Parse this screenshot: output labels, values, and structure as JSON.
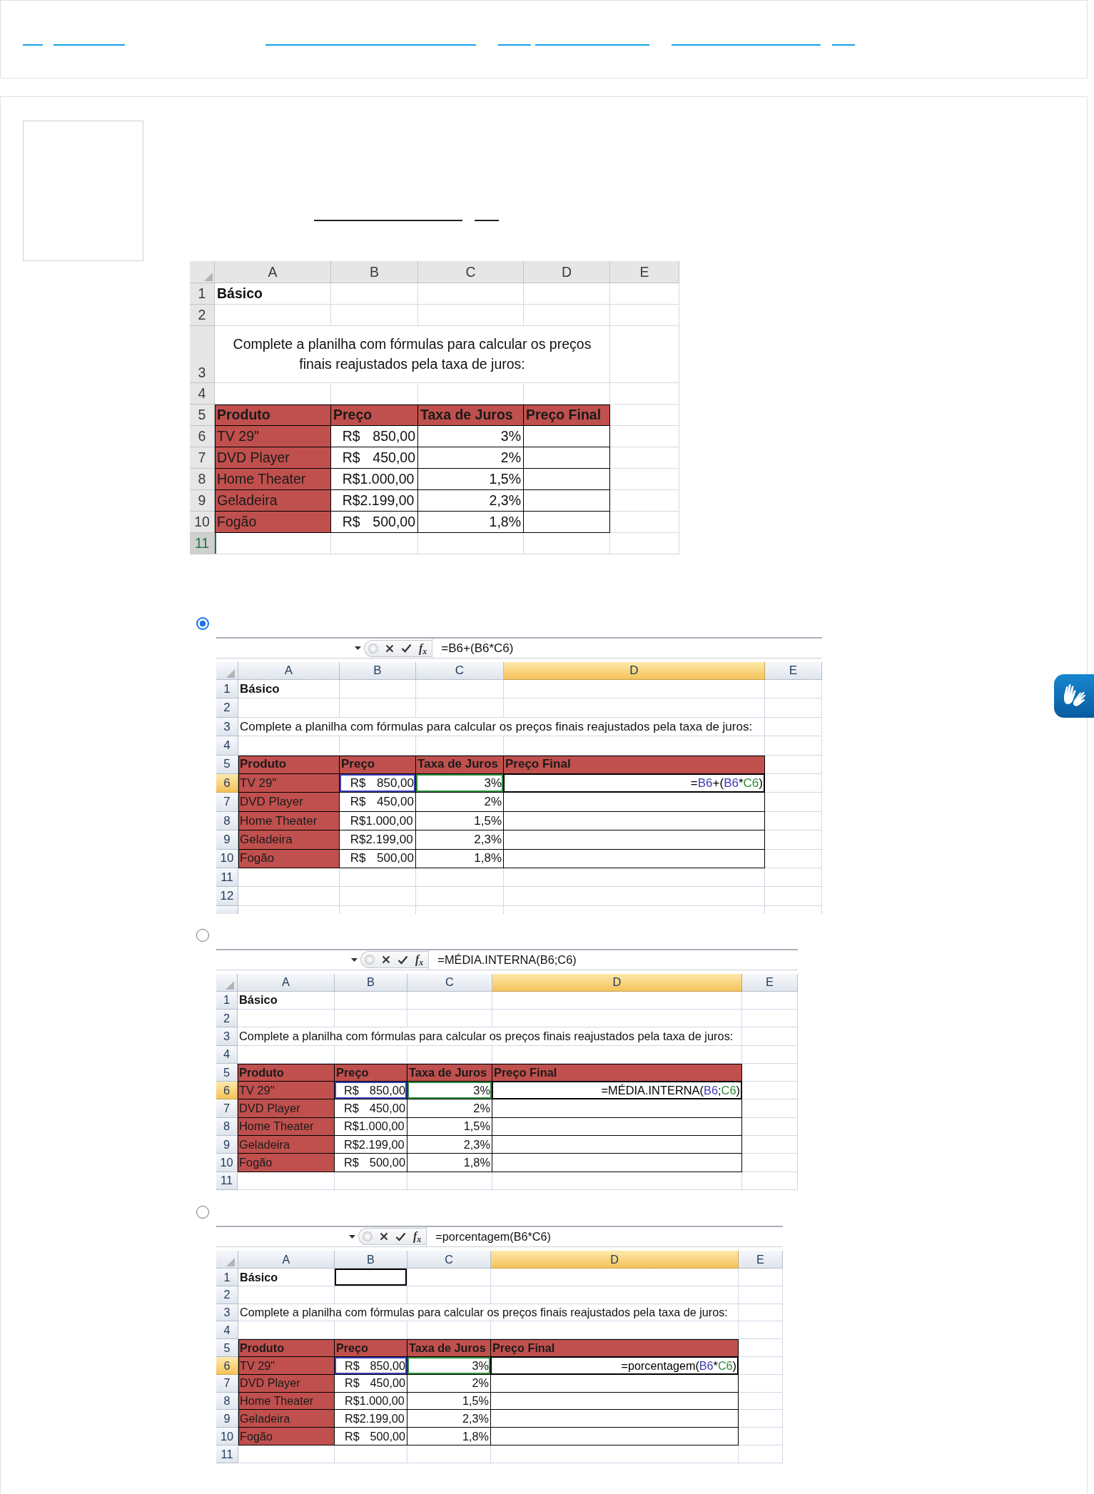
{
  "question": {
    "spreadsheet": {
      "kind": "excel2016",
      "columns": [
        {
          "label": "A",
          "selected": false
        },
        {
          "label": "B",
          "selected": false
        },
        {
          "label": "C",
          "selected": false
        },
        {
          "label": "D",
          "selected": false
        },
        {
          "label": "E",
          "selected": false
        }
      ],
      "rows": [
        {
          "number": "1",
          "selected": false,
          "kind": "title",
          "cells": [
            {
              "text": "Básico"
            }
          ]
        },
        {
          "number": "2",
          "selected": false,
          "kind": "blank"
        },
        {
          "number": "3",
          "selected": false,
          "kind": "note",
          "cells": [
            {
              "text": "Complete a planilha com fórmulas para calcular os preços finais reajustados pela taxa de juros:"
            }
          ]
        },
        {
          "number": "4",
          "selected": false,
          "kind": "blank"
        },
        {
          "number": "5",
          "selected": false,
          "kind": "header",
          "cells": [
            {
              "text": "Produto"
            },
            {
              "text": "Preço"
            },
            {
              "text": "Taxa de Juros"
            },
            {
              "text": "Preço Final"
            }
          ]
        },
        {
          "number": "6",
          "selected": false,
          "kind": "data",
          "cells": [
            {
              "text": "TV 29\""
            },
            {
              "text": "R$ 850,00"
            },
            {
              "text": "3%"
            }
          ]
        },
        {
          "number": "7",
          "selected": false,
          "kind": "data",
          "cells": [
            {
              "text": "DVD Player"
            },
            {
              "text": "R$ 450,00"
            },
            {
              "text": "2%"
            }
          ]
        },
        {
          "number": "8",
          "selected": false,
          "kind": "data",
          "cells": [
            {
              "text": "Home Theater"
            },
            {
              "text": "R$1.000,00"
            },
            {
              "text": "1,5%"
            }
          ]
        },
        {
          "number": "9",
          "selected": false,
          "kind": "data",
          "cells": [
            {
              "text": "Geladeira"
            },
            {
              "text": "R$2.199,00"
            },
            {
              "text": "2,3%"
            }
          ]
        },
        {
          "number": "10",
          "selected": false,
          "kind": "data",
          "cells": [
            {
              "text": "Fogão"
            },
            {
              "text": "R$ 500,00"
            },
            {
              "text": "1,8%"
            }
          ]
        },
        {
          "number": "11",
          "selected": true,
          "kind": "blank"
        }
      ]
    }
  },
  "options": [
    {
      "selected": true,
      "spreadsheet": {
        "kind": "excel2010",
        "formula": "=B6+(B6*C6)",
        "function_label": "f$_{x}$",
        "columns": [
          {
            "label": "A",
            "selected": false
          },
          {
            "label": "B",
            "selected": false
          },
          {
            "label": "C",
            "selected": false
          },
          {
            "label": "D",
            "selected": true
          },
          {
            "label": "E",
            "selected": false
          }
        ],
        "rows": [
          {
            "number": "1",
            "selected": false,
            "kind": "title",
            "cells": [
              {
                "text": "Básico"
              }
            ]
          },
          {
            "number": "2",
            "selected": false,
            "kind": "blank"
          },
          {
            "number": "3",
            "selected": false,
            "kind": "note",
            "cells": [
              {
                "text": "Complete a planilha com fórmulas para calcular os preços finais reajustados pela taxa de juros:"
              }
            ]
          },
          {
            "number": "4",
            "selected": false,
            "kind": "blank"
          },
          {
            "number": "5",
            "selected": false,
            "kind": "header",
            "cells": [
              {
                "text": "Produto"
              },
              {
                "text": "Preço"
              },
              {
                "text": "Taxa de Juros"
              },
              {
                "text": "Preço Final"
              }
            ]
          },
          {
            "number": "6",
            "selected": true,
            "kind": "data",
            "cells": [
              {
                "text": "TV 29\""
              },
              {
                "text": "R$ 850,00",
                "color": "#3c3cb4"
              },
              {
                "text": "3%",
                "color": "#2e8b3a"
              },
              {
                "parts": [
                  {
                    "text": "="
                  },
                  {
                    "text": "B6",
                    "color": "#3c3cb4"
                  },
                  {
                    "text": "+("
                  },
                  {
                    "text": "B6",
                    "color": "#3c3cb4"
                  },
                  {
                    "text": "*"
                  },
                  {
                    "text": "C6",
                    "color": "#2e8b3a"
                  },
                  {
                    "text": ")"
                  }
                ]
              }
            ]
          },
          {
            "number": "7",
            "selected": false,
            "kind": "data",
            "cells": [
              {
                "text": "DVD Player"
              },
              {
                "text": "R$ 450,00"
              },
              {
                "text": "2%"
              }
            ]
          },
          {
            "number": "8",
            "selected": false,
            "kind": "data",
            "cells": [
              {
                "text": "Home Theater"
              },
              {
                "text": "R$1.000,00"
              },
              {
                "text": "1,5%"
              }
            ]
          },
          {
            "number": "9",
            "selected": false,
            "kind": "data",
            "cells": [
              {
                "text": "Geladeira"
              },
              {
                "text": "R$2.199,00"
              },
              {
                "text": "2,3%"
              }
            ]
          },
          {
            "number": "10",
            "selected": false,
            "kind": "data",
            "cells": [
              {
                "text": "Fogão"
              },
              {
                "text": "R$ 500,00"
              },
              {
                "text": "1,8%"
              }
            ]
          },
          {
            "number": "11",
            "selected": false,
            "kind": "blank"
          },
          {
            "number": "12",
            "selected": false,
            "kind": "blank"
          },
          {
            "selected": false,
            "kind": "blank"
          }
        ]
      }
    },
    {
      "selected": false,
      "spreadsheet": {
        "kind": "excel2010",
        "formula": "=MÉDIA.INTERNA(B6;C6)",
        "function_label": "f$_{x}$",
        "columns": [
          {
            "label": "A",
            "selected": false
          },
          {
            "label": "B",
            "selected": false
          },
          {
            "label": "C",
            "selected": false
          },
          {
            "label": "D",
            "selected": true
          },
          {
            "label": "E",
            "selected": false
          }
        ],
        "rows": [
          {
            "number": "1",
            "selected": false,
            "kind": "title",
            "cells": [
              {
                "text": "Básico"
              }
            ]
          },
          {
            "number": "2",
            "selected": false,
            "kind": "blank"
          },
          {
            "number": "3",
            "selected": false,
            "kind": "note",
            "cells": [
              {
                "text": "Complete a planilha com fórmulas para calcular os preços finais reajustados pela taxa de juros:"
              }
            ]
          },
          {
            "number": "4",
            "selected": false,
            "kind": "blank"
          },
          {
            "number": "5",
            "selected": false,
            "kind": "header",
            "cells": [
              {
                "text": "Produto"
              },
              {
                "text": "Preço"
              },
              {
                "text": "Taxa de Juros"
              },
              {
                "text": "Preço Final"
              }
            ]
          },
          {
            "number": "6",
            "selected": true,
            "kind": "data",
            "cells": [
              {
                "text": "TV 29\""
              },
              {
                "text": "R$ 850,00",
                "color": "#3c3cb4"
              },
              {
                "text": "3%",
                "color": "#2e8b3a"
              },
              {
                "parts": [
                  {
                    "text": "=MÉDIA.INTERNA("
                  },
                  {
                    "text": "B6",
                    "color": "#3c3cb4"
                  },
                  {
                    "text": ";"
                  },
                  {
                    "text": "C6",
                    "color": "#2e8b3a"
                  },
                  {
                    "text": ")"
                  }
                ]
              }
            ]
          },
          {
            "number": "7",
            "selected": false,
            "kind": "data",
            "cells": [
              {
                "text": "DVD Player"
              },
              {
                "text": "R$ 450,00"
              },
              {
                "text": "2%"
              }
            ]
          },
          {
            "number": "8",
            "selected": false,
            "kind": "data",
            "cells": [
              {
                "text": "Home Theater"
              },
              {
                "text": "R$1.000,00"
              },
              {
                "text": "1,5%"
              }
            ]
          },
          {
            "number": "9",
            "selected": false,
            "kind": "data",
            "cells": [
              {
                "text": "Geladeira"
              },
              {
                "text": "R$2.199,00"
              },
              {
                "text": "2,3%"
              }
            ]
          },
          {
            "number": "10",
            "selected": false,
            "kind": "data",
            "cells": [
              {
                "text": "Fogão"
              },
              {
                "text": "R$ 500,00"
              },
              {
                "text": "1,8%"
              }
            ]
          },
          {
            "number": "11",
            "selected": false,
            "kind": "blank"
          }
        ]
      }
    },
    {
      "selected": false,
      "spreadsheet": {
        "kind": "excel2010",
        "formula": "=porcentagem(B6*C6)",
        "function_label": "f$_{x}$",
        "columns": [
          {
            "label": "A",
            "selected": false
          },
          {
            "label": "B",
            "selected": false
          },
          {
            "label": "C",
            "selected": false
          },
          {
            "label": "D",
            "selected": true
          },
          {
            "label": "E",
            "selected": false
          }
        ],
        "rows": [
          {
            "number": "1",
            "selected": false,
            "kind": "title",
            "cells": [
              {
                "text": "Básico"
              },
              {
                "outlined": true
              }
            ]
          },
          {
            "number": "2",
            "selected": false,
            "kind": "blank"
          },
          {
            "number": "3",
            "selected": false,
            "kind": "note",
            "cells": [
              {
                "text": "Complete a planilha com fórmulas para calcular os preços finais reajustados pela taxa de juros:"
              }
            ]
          },
          {
            "number": "4",
            "selected": false,
            "kind": "blank"
          },
          {
            "number": "5",
            "selected": false,
            "kind": "header",
            "cells": [
              {
                "text": "Produto"
              },
              {
                "text": "Preço"
              },
              {
                "text": "Taxa de Juros"
              },
              {
                "text": "Preço Final"
              }
            ]
          },
          {
            "number": "6",
            "selected": true,
            "kind": "data",
            "cells": [
              {
                "text": "TV 29\""
              },
              {
                "text": "R$ 850,00",
                "color": "#3c3cb4"
              },
              {
                "text": "3%",
                "color": "#2e8b3a"
              },
              {
                "parts": [
                  {
                    "text": "=porcentagem("
                  },
                  {
                    "text": "B6",
                    "color": "#3c3cb4"
                  },
                  {
                    "text": "*"
                  },
                  {
                    "text": "C6",
                    "color": "#2e8b3a"
                  },
                  {
                    "text": ")"
                  }
                ]
              }
            ]
          },
          {
            "number": "7",
            "selected": false,
            "kind": "data",
            "cells": [
              {
                "text": "DVD Player"
              },
              {
                "text": "R$ 450,00"
              },
              {
                "text": "2%"
              }
            ]
          },
          {
            "number": "8",
            "selected": false,
            "kind": "data",
            "cells": [
              {
                "text": "Home Theater"
              },
              {
                "text": "R$1.000,00"
              },
              {
                "text": "1,5%"
              }
            ]
          },
          {
            "number": "9",
            "selected": false,
            "kind": "data",
            "cells": [
              {
                "text": "Geladeira"
              },
              {
                "text": "R$2.199,00"
              },
              {
                "text": "2,3%"
              }
            ]
          },
          {
            "number": "10",
            "selected": false,
            "kind": "data",
            "cells": [
              {
                "text": "Fogão"
              },
              {
                "text": "R$ 500,00"
              },
              {
                "text": "1,8%"
              }
            ]
          },
          {
            "number": "11",
            "selected": false,
            "kind": "blank"
          }
        ]
      }
    }
  ]
}
